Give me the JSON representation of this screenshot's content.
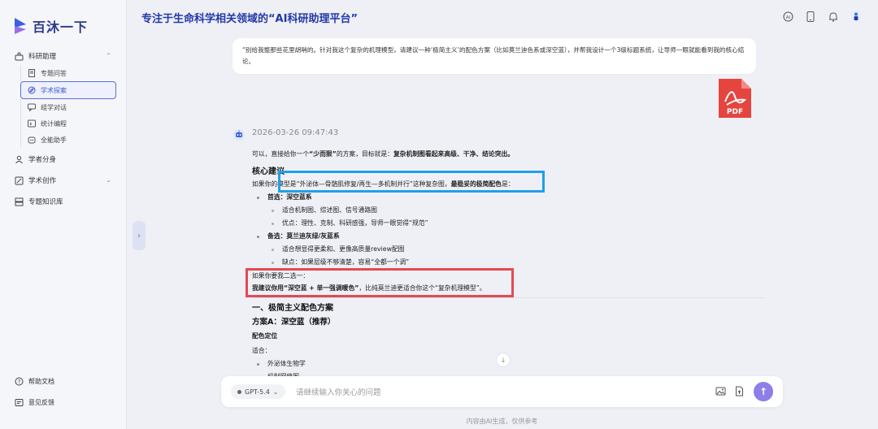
{
  "app": {
    "name": "百沐一下",
    "page_title": "专注于生命科学相关领域的“AI科研助理平台”"
  },
  "sidebar": {
    "groups": [
      {
        "label": "科研助理",
        "expanded": true,
        "items": [
          {
            "label": "专题问答",
            "icon": "document-icon"
          },
          {
            "label": "学术探索",
            "icon": "compass-icon",
            "active": true
          },
          {
            "label": "组学对话",
            "icon": "chat-icon"
          },
          {
            "label": "统计编程",
            "icon": "code-icon"
          },
          {
            "label": "全能助手",
            "icon": "assistant-icon"
          }
        ]
      },
      {
        "label": "学者分身",
        "icon": "scholar-icon"
      },
      {
        "label": "学术创作",
        "icon": "edit-icon",
        "expandable": true
      },
      {
        "label": "专题知识库",
        "icon": "library-icon"
      }
    ],
    "footer": {
      "help": "帮助文档",
      "feedback": "意见反馈"
    }
  },
  "conversation": {
    "user_message": "“别给我整那些花里胡哨的。针对我这个复杂的机理模型，请建议一种‘极简主义’的配色方案（比如莫兰迪色系或深空蓝），并帮我设计一个3级标题系统，让导师一眼就能看到我的核心结论。",
    "attachment": {
      "type": "PDF"
    },
    "timestamp": "2026-03-26 09:47:43",
    "answer": {
      "intro_a": "可以，直接给你一个",
      "intro_b": "“少而狠”",
      "intro_c": "的方案，目标就是：",
      "intro_d": "复杂机制图看起来高级、干净、结论突出。",
      "core_heading": "核心建议",
      "core_text_a": "如果你的模型是“外泌体—骨骼肌修复/再生—多机制并行”这种复杂图，",
      "core_text_b": "最稳妥的极简配色",
      "core_text_c": "是：",
      "option1_title": "首选：深空蓝系",
      "option1_points": [
        "适合机制图、综述图、信号通路图",
        "优点：理性、克制、科研感强，导师一眼觉得“规范”"
      ],
      "option2_title": "备选：莫兰迪灰绿/灰蓝系",
      "option2_points": [
        "适合想显得更柔和、更像高质量review配图",
        "缺点：如果层级不够清楚，容易“全都一个调”"
      ],
      "choose_line": "如果你要我二选一：",
      "recommend_a": "我建议你用“深空蓝 + 单一强调暖色”",
      "recommend_b": "，比纯莫兰迪更适合你这个“复杂机理模型”。",
      "section1": "一、极简主义配色方案",
      "planA": "方案A：深空蓝（推荐）",
      "color_pos": "配色定位",
      "suitable": "适合：",
      "suit_items": [
        "外泌体生物学",
        "机制网络图"
      ]
    }
  },
  "input": {
    "model": "GPT-5.4",
    "placeholder": "请继续输入你关心的问题"
  },
  "footer_note": "内容由AI生成，仅供参考",
  "colors": {
    "accent": "#3b55c9",
    "send": "#8d7ee8",
    "highlight_blue": "#1ea0e8",
    "highlight_red": "#e5494f",
    "pdf_red": "#e5453f"
  }
}
